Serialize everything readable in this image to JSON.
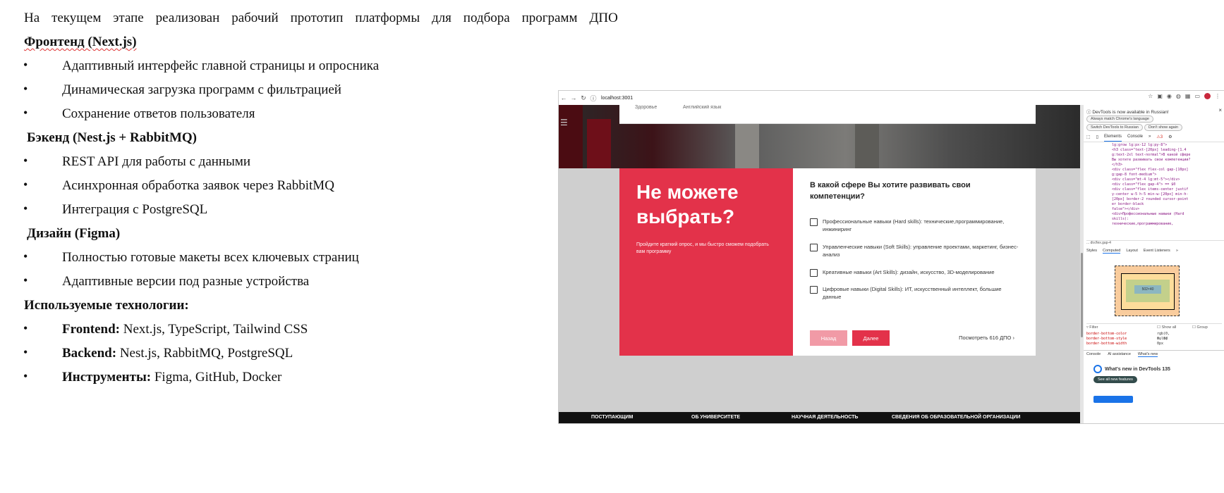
{
  "doc": {
    "intro": "На текущем этапе реализован рабочий прототип платформы для подбора программ ДПО",
    "sections": [
      {
        "heading": "Фронтенд (Next.js)",
        "items": [
          "Адаптивный интерфейс главной страницы и опросника",
          "Динамическая загрузка программ с фильтрацией",
          "Сохранение ответов пользователя"
        ]
      },
      {
        "heading": "Бэкенд (Nest.js + RabbitMQ)",
        "items": [
          "REST API для работы с данными",
          "Асинхронная обработка заявок через RabbitMQ",
          "Интеграция с PostgreSQL"
        ]
      },
      {
        "heading": "Дизайн (Figma)",
        "items": [
          "Полностью готовые макеты всех ключевых страниц",
          "Адаптивные версии под разные устройства"
        ]
      }
    ],
    "tech_heading": "Используемые технологии:",
    "tech": [
      {
        "label": "Frontend:",
        "value": "Next.js, TypeScript, Tailwind CSS"
      },
      {
        "label": "Backend:",
        "value": "Nest.js, RabbitMQ, PostgreSQL"
      },
      {
        "label": "Инструменты:",
        "value": "Figma, GitHub, Docker"
      }
    ],
    "bullet": "•"
  },
  "browser": {
    "url": "localhost:3001",
    "topcard_left": "Здоровье",
    "topcard_right": "Английский язык",
    "panel_title": "Не можете выбрать?",
    "panel_sub": "Пройдите краткий опрос, и мы быстро сможем подобрать вам программу",
    "question": "В какой сфере Вы хотите развивать свои компетенции?",
    "options": [
      "Профессиональные навыки (Hard skills): технические,программирование, инжиниринг",
      "Управленческие навыки (Soft Skills): управление проектами, маркетинг, бизнес-анализ",
      "Креативные навыки (Art Skills): дизайн, искусство, 3D-моделирование",
      "Цифровые навыки (Digital Skills): ИТ, искусственный интеллект, большие данные"
    ],
    "back": "Назад",
    "next": "Далее",
    "view_all": "Посмотреть 616 ДПО",
    "footer": [
      "ПОСТУПАЮЩИМ",
      "ОБ УНИВЕРСИТЕТЕ",
      "НАУЧНАЯ ДЕЯТЕЛЬНОСТЬ",
      "СВЕДЕНИЯ ОБ ОБРАЗОВАТЕЛЬНОЙ ОРГАНИЗАЦИИ"
    ]
  },
  "devtools": {
    "notice": "DevTools is now available in Russian!",
    "btn1": "Always match Chrome's language",
    "btn2": "Switch DevTools to Russian",
    "btn3": "Don't show again",
    "tabs": [
      "Elements",
      "Console",
      "»"
    ],
    "issues": "3",
    "code": [
      "lg:grow lg:px-12 lg:py-8\">",
      "<h3 class=\"text-[20px] leading-[1.4",
      "g:text-2xl text-normal\">В какой сфере",
      "Вы хотите развивать свои компетенции?",
      "</h3>",
      "<div class=\"flex flex-col gap-[10px]",
      "g:gap-8 font-medium\">",
      "<div class=\"mt-4 lg:mt-5\"></div>",
      "<div class=\"flex gap-4\"> == $0",
      "<div class=\"flex items-center justif",
      "y-center w-5 h-5 min-w-[20px] min-h-",
      "[20px] border-2 rounded cursor-point",
      "er border-black",
      "false\"></div>",
      "<div>Профессиональные навыки (Hard",
      "skills):",
      "технические,программирование,"
    ],
    "crumb": "... div.flex.gap-4",
    "style_tabs": [
      "Styles",
      "Computed",
      "Layout",
      "Event Listeners",
      "»"
    ],
    "box_content": "502×40",
    "filter": "Filter",
    "show_all": "Show all",
    "group": "Group",
    "props": [
      {
        "k": "border-bottom-color",
        "v": "rgb(0, 0, 0)"
      },
      {
        "k": "border-bottom-style",
        "v": "solid"
      },
      {
        "k": "border-bottom-width",
        "v": "0px"
      }
    ],
    "drawer_tabs": [
      "Console",
      "AI assistance",
      "What's new"
    ],
    "whats_new": "What's new in DevTools 135",
    "see_all": "See all new features"
  }
}
